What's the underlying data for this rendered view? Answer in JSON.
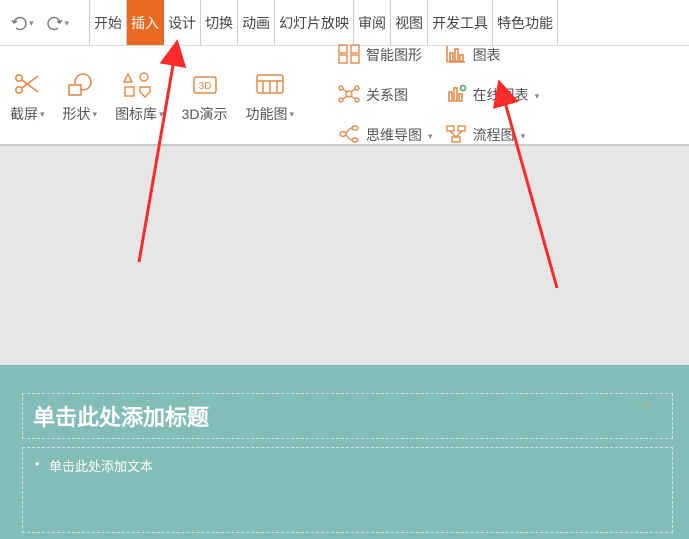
{
  "tabs": {
    "start": "开始",
    "insert": "插入",
    "design": "设计",
    "transition": "切换",
    "animation": "动画",
    "slideshow": "幻灯片放映",
    "review": "审阅",
    "view": "视图",
    "developer": "开发工具",
    "special": "特色功能"
  },
  "ribbon": {
    "cut_screen": "截屏",
    "shapes": "形状",
    "icon_library": "图标库",
    "presentation_3d": "3D演示",
    "function_chart": "功能图",
    "smart_graphic": "智能图形",
    "chart": "图表",
    "relation": "关系图",
    "online_chart": "在线图表",
    "mindmap": "思维导图",
    "flowchart": "流程图"
  },
  "slide": {
    "title_placeholder": "单击此处添加标题",
    "content_placeholder": "单击此处添加文本"
  }
}
